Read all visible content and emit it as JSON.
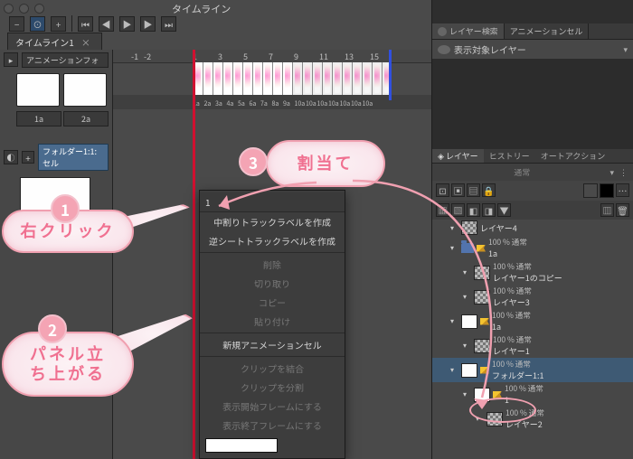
{
  "window": {
    "title": "タイムライン",
    "timeline_tab": "タイムライン1"
  },
  "ruler": {
    "start_neg": [
      "-1",
      "-2"
    ],
    "marks": [
      "1",
      "3",
      "5",
      "7",
      "9",
      "11",
      "13",
      "15"
    ],
    "track_tabs_head": [
      "1a",
      "2a"
    ]
  },
  "frame_labels_a": [
    "1a",
    "2a",
    "3a",
    "4a",
    "5a",
    "6a",
    "7a",
    "8a",
    "9a"
  ],
  "frame_labels_b": [
    "10a",
    "10a",
    "10a",
    "10a",
    "10a",
    "10a",
    "10a"
  ],
  "track_head": {
    "folder_label": "アニメーションフォ",
    "new_folder": "フォルダー1:1: セル"
  },
  "right": {
    "tabs1": {
      "search": "レイヤー検索",
      "cel": "アニメーションセル"
    },
    "search_label": "表示対象レイヤー",
    "tabs2": {
      "layer": "レイヤー",
      "history": "ヒストリー",
      "auto": "オートアクション"
    },
    "mode": "通常"
  },
  "layers": [
    {
      "op": "",
      "name": "レイヤー4",
      "lvl": 1,
      "checker": true
    },
    {
      "op": "100 % 通常",
      "name": "1a",
      "lvl": 1,
      "flag": true
    },
    {
      "op": "100 % 通常",
      "name": "レイヤー1のコピー",
      "lvl": 2,
      "checker": true
    },
    {
      "op": "100 % 通常",
      "name": "レイヤー3",
      "lvl": 2,
      "checker": true
    },
    {
      "op": "100 % 通常",
      "name": "1a",
      "lvl": 1,
      "thumb": true,
      "flag": true
    },
    {
      "op": "100 % 通常",
      "name": "レイヤー1",
      "lvl": 2,
      "checker": true
    },
    {
      "op": "100 % 通常",
      "name": "フォルダー1:1",
      "lvl": 1,
      "thumb": true,
      "flag": true,
      "sel": true
    },
    {
      "op": "100 % 通常",
      "name": "1",
      "lvl": 2,
      "flag": true,
      "thumb": true,
      "highlight": true
    },
    {
      "op": "100 % 通常",
      "name": "レイヤー2",
      "lvl": 3,
      "checker": true
    }
  ],
  "context_menu": {
    "head": "1",
    "items": [
      {
        "t": "中割りトラックラベルを作成",
        "dim": false
      },
      {
        "t": "逆シートトラックラベルを作成",
        "dim": false
      },
      {
        "sep": true
      },
      {
        "t": "削除",
        "dim": true
      },
      {
        "t": "切り取り",
        "dim": true
      },
      {
        "t": "コピー",
        "dim": true
      },
      {
        "t": "貼り付け",
        "dim": true
      },
      {
        "sep": true
      },
      {
        "t": "新規アニメーションセル",
        "dim": false
      },
      {
        "sep": true
      },
      {
        "t": "クリップを結合",
        "dim": true
      },
      {
        "t": "クリップを分割",
        "dim": true
      },
      {
        "t": "表示開始フレームにする",
        "dim": true
      },
      {
        "t": "表示終了フレームにする",
        "dim": true
      }
    ],
    "input_value": ""
  },
  "annotations": {
    "b1": "右クリック",
    "b2": "パネル立\nち上がる",
    "b3": "割当て"
  }
}
